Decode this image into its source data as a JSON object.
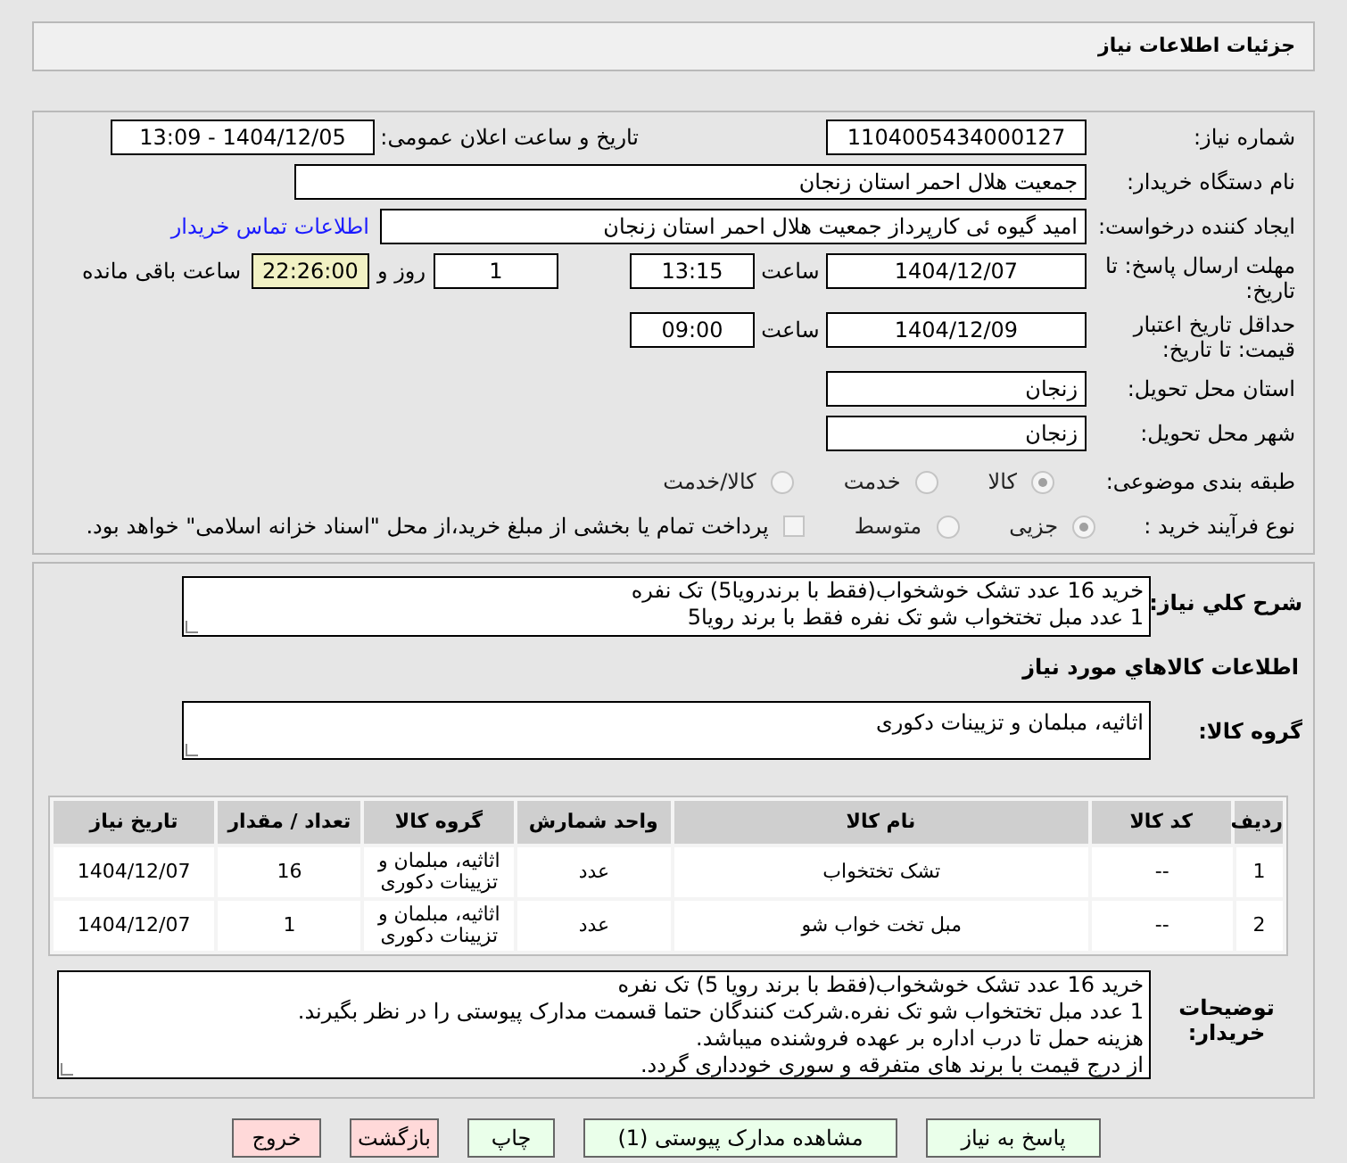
{
  "header": {
    "title": "جزئیات اطلاعات نیاز"
  },
  "need_number": {
    "label": "شماره نیاز:",
    "value": "1104005434000127"
  },
  "announce": {
    "label": "تاریخ و ساعت اعلان عمومی:",
    "value": "1404/12/05 - 13:09"
  },
  "buyer_org": {
    "label": "نام دستگاه خریدار:",
    "value": "جمعیت هلال احمر استان زنجان"
  },
  "requester": {
    "label": "ایجاد کننده درخواست:",
    "value": "امید گیوه ئی کارپرداز  جمعیت هلال احمر استان زنجان",
    "link": "اطلاعات تماس خریدار"
  },
  "deadline": {
    "label": "مهلت ارسال پاسخ: تا تاریخ:",
    "date": "1404/12/07",
    "time_label": "ساعت",
    "time": "13:15",
    "days": "1",
    "days_label": "روز و",
    "remaining": "22:26:00",
    "remaining_label": "ساعت باقی مانده"
  },
  "validity": {
    "label": "حداقل تاریخ اعتبار قیمت: تا تاریخ:",
    "date": "1404/12/09",
    "time_label": "ساعت",
    "time": "09:00"
  },
  "province": {
    "label": "استان محل تحویل:",
    "value": "زنجان"
  },
  "city": {
    "label": "شهر محل تحویل:",
    "value": "زنجان"
  },
  "category": {
    "label": "طبقه بندی موضوعی:",
    "options": [
      {
        "label": "کالا",
        "selected": true
      },
      {
        "label": "خدمت",
        "selected": false
      },
      {
        "label": "کالا/خدمت",
        "selected": false
      }
    ]
  },
  "process": {
    "label": "نوع فرآیند خرید :",
    "options": [
      {
        "label": "جزیی",
        "selected": true
      },
      {
        "label": "متوسط",
        "selected": false
      }
    ],
    "payment_checked": false,
    "payment_note": "پرداخت تمام یا بخشی از مبلغ خرید،از محل \"اسناد خزانه اسلامی\" خواهد بود."
  },
  "summary": {
    "label": "شرح کلي نياز:",
    "lines": [
      "خرید 16 عدد تشک خوشخواب(فقط با برندرویا5) تک نفره",
      "1 عدد مبل تختخواب شو تک نفره فقط با برند رویا5"
    ]
  },
  "goods_heading": "اطلاعات کالاهاي مورد نياز",
  "goods_group": {
    "label": "گروه کالا:",
    "value": "اثاثیه، مبلمان و تزیینات دکوری"
  },
  "table": {
    "columns": [
      "ردیف",
      "کد کالا",
      "نام کالا",
      "واحد شمارش",
      "گروه کالا",
      "تعداد / مقدار",
      "تاریخ نیاز"
    ],
    "rows": [
      [
        "1",
        "--",
        "تشک تختخواب",
        "عدد",
        "اثاثیه، مبلمان و تزیینات دکوری",
        "16",
        "1404/12/07"
      ],
      [
        "2",
        "--",
        "مبل تخت خواب شو",
        "عدد",
        "اثاثیه، مبلمان و تزیینات دکوری",
        "1",
        "1404/12/07"
      ]
    ]
  },
  "buyer_notes": {
    "label": "توضیحات خریدار:",
    "lines": [
      "خرید 16 عدد تشک خوشخواب(فقط با برند رویا 5) تک نفره",
      "1 عدد مبل تختخواب شو تک نفره.شرکت کنندگان حتما قسمت مدارک پیوستی را در نظر بگیرند.",
      "هزینه حمل تا درب اداره بر عهده فروشنده میباشد.",
      "از درج قیمت با برند های متفرقه و سوری خودداری گردد."
    ]
  },
  "buttons": [
    {
      "label": "پاسخ به نیاز",
      "kind": "normal"
    },
    {
      "label": "مشاهده مدارک پیوستی (1)",
      "kind": "normal"
    },
    {
      "label": "چاپ",
      "kind": "normal"
    },
    {
      "label": "بازگشت",
      "kind": "danger"
    },
    {
      "label": "خروج",
      "kind": "danger"
    }
  ]
}
